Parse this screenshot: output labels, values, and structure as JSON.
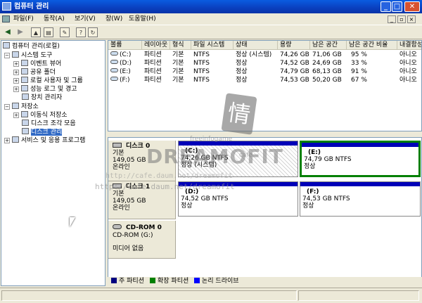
{
  "window": {
    "title": "컴퓨터 관리",
    "minimize": "_",
    "maximize": "□",
    "close": "✕"
  },
  "menubar": {
    "items": [
      "파일(F)",
      "동작(A)",
      "보기(V)",
      "창(W)",
      "도움말(H)"
    ],
    "mdi_min": "_",
    "mdi_restore": "▫",
    "mdi_close": "×"
  },
  "toolbar": {
    "back": "◀",
    "forward": "▶",
    "up": "▲",
    "show_tree": "▤",
    "properties": "✎",
    "help": "?",
    "refresh": "↻"
  },
  "tree": {
    "root": "컴퓨터 관리(로컬)",
    "system_tools": "시스템 도구",
    "event_viewer": "이벤트 뷰어",
    "shared_folders": "공유 폴더",
    "local_users": "로컬 사용자 및 그룹",
    "perf_logs": "성능 로그 및 경고",
    "device_manager": "장치 관리자",
    "storage": "저장소",
    "removable": "이동식 저장소",
    "defrag": "디스크 조각 모음",
    "disk_mgmt": "디스크 관리",
    "services": "서비스 및 응용 프로그램"
  },
  "volumes": {
    "columns": [
      "볼륨",
      "레이아웃",
      "형식",
      "파일 시스템",
      "상태",
      "용량",
      "남은 공간",
      "남은 공간 비율",
      "내결함성"
    ],
    "rows": [
      [
        "(C:)",
        "파티션",
        "기본",
        "NTFS",
        "정상 (시스템)",
        "74,26 GB",
        "71,06 GB",
        "95 %",
        "아니오"
      ],
      [
        "(D:)",
        "파티션",
        "기본",
        "NTFS",
        "정상",
        "74,52 GB",
        "24,69 GB",
        "33 %",
        "아니오"
      ],
      [
        "(E:)",
        "파티션",
        "기본",
        "NTFS",
        "정상",
        "74,79 GB",
        "68,13 GB",
        "91 %",
        "아니오"
      ],
      [
        "(F:)",
        "파티션",
        "기본",
        "NTFS",
        "정상",
        "74,53 GB",
        "50,20 GB",
        "67 %",
        "아니오"
      ]
    ]
  },
  "disks": [
    {
      "name": "디스크 0",
      "type": "기본",
      "size": "149,05 GB",
      "status": "온라인",
      "partitions": [
        {
          "label": "(C:)",
          "info": "74,26 GB NTFS",
          "status": "정상 (시스템)"
        },
        {
          "label": "(E:)",
          "info": "74,79 GB NTFS",
          "status": "정상"
        }
      ]
    },
    {
      "name": "디스크 1",
      "type": "기본",
      "size": "149,05 GB",
      "status": "온라인",
      "partitions": [
        {
          "label": "(D:)",
          "info": "74,52 GB NTFS",
          "status": "정상"
        },
        {
          "label": "(F:)",
          "info": "74,53 GB NTFS",
          "status": "정상"
        }
      ]
    },
    {
      "name": "CD-ROM 0",
      "type": "CD-ROM (G:)",
      "size": "",
      "status": "미디어 없음",
      "partitions": []
    }
  ],
  "legend": {
    "primary": "주 파티션",
    "extended": "확장 파티션",
    "logical": "논리 드라이브",
    "colors": {
      "primary": "#000080",
      "extended": "#008000",
      "logical": "#0000ff"
    }
  },
  "watermark": {
    "logo_char": "情",
    "brand": "DREAMOFIT",
    "small": "freeinfogame",
    "site": "cafe",
    "url": "http://cafe.daum.net/dreamofit"
  }
}
